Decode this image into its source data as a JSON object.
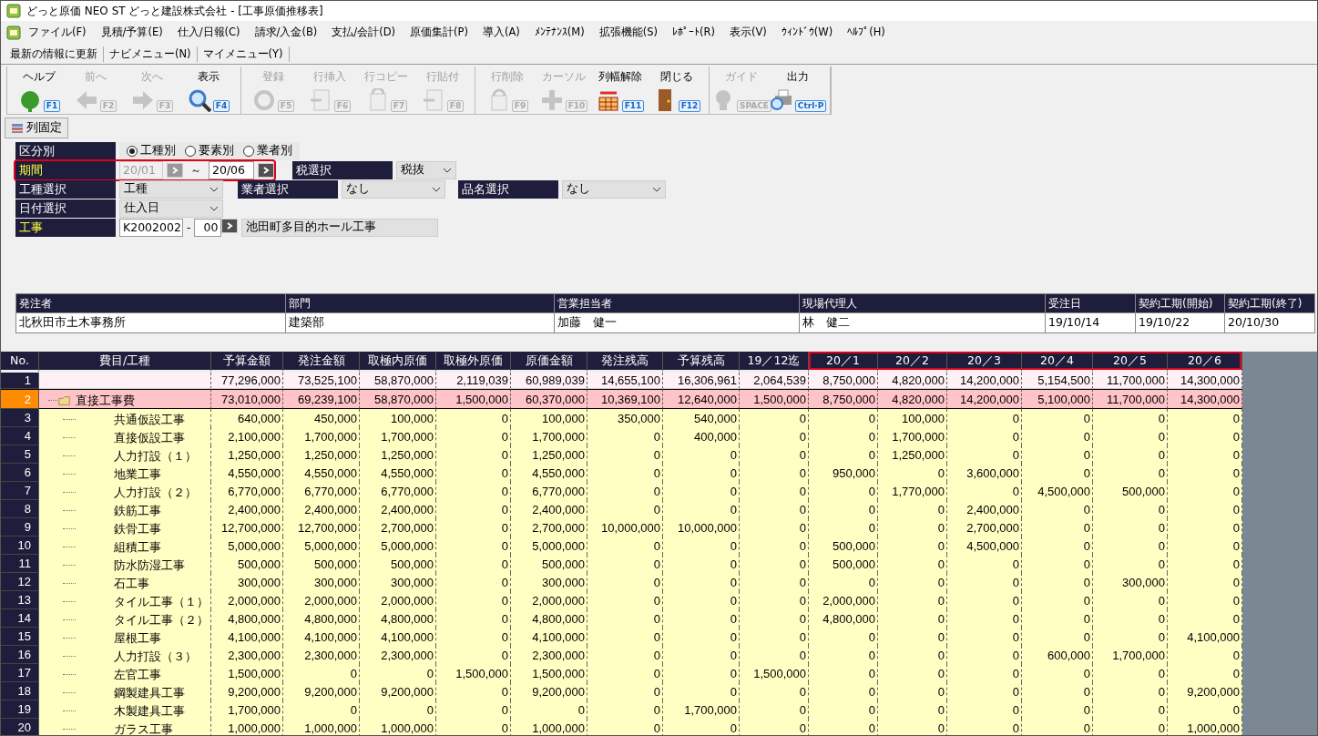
{
  "window": {
    "title": "どっと原価 NEO ST どっと建設株式会社 - [工事原価推移表]"
  },
  "menu_bar": [
    "ファイル(F)",
    "見積/予算(E)",
    "仕入/日報(C)",
    "請求/入金(B)",
    "支払/会計(D)",
    "原価集計(P)",
    "導入(A)",
    "ﾒﾝﾃﾅﾝｽ(M)",
    "拡張機能(S)",
    "ﾚﾎﾟｰﾄ(R)",
    "表示(V)",
    "ｳｨﾝﾄﾞｳ(W)",
    "ﾍﾙﾌﾟ(H)"
  ],
  "quick_bar": [
    "最新の情報に更新",
    "ナビメニュー(N)",
    "マイメニュー(Y)"
  ],
  "toolbar": {
    "groups": [
      [
        {
          "label": "ヘルプ",
          "key": "F1",
          "disabled": false
        },
        {
          "label": "前へ",
          "key": "F2",
          "disabled": true
        },
        {
          "label": "次へ",
          "key": "F3",
          "disabled": true
        },
        {
          "label": "表示",
          "key": "F4",
          "disabled": false
        }
      ],
      [
        {
          "label": "登録",
          "key": "F5",
          "disabled": true
        },
        {
          "label": "行挿入",
          "key": "F6",
          "disabled": true
        },
        {
          "label": "行コピー",
          "key": "F7",
          "disabled": true
        },
        {
          "label": "行貼付",
          "key": "F8",
          "disabled": true
        }
      ],
      [
        {
          "label": "行削除",
          "key": "F9",
          "disabled": true
        },
        {
          "label": "カーソル",
          "key": "F10",
          "disabled": true
        },
        {
          "label": "列幅解除",
          "key": "F11",
          "disabled": false
        },
        {
          "label": "閉じる",
          "key": "F12",
          "disabled": false
        }
      ],
      [
        {
          "label": "ガイド",
          "key": "SPACE",
          "disabled": true
        },
        {
          "label": "出力",
          "key": "Ctrl·P",
          "disabled": false
        }
      ]
    ]
  },
  "freeze_button": "列固定",
  "filters": {
    "grouping": {
      "label": "区分別",
      "options": [
        {
          "label": "工種別",
          "selected": true
        },
        {
          "label": "要素別",
          "selected": false
        },
        {
          "label": "業者別",
          "selected": false
        }
      ]
    },
    "period": {
      "label": "期間",
      "required": true,
      "highlighted": true,
      "from": {
        "value": "20/01",
        "disabled": true
      },
      "separator": "～",
      "to": {
        "value": "20/06",
        "disabled": false
      }
    },
    "tax": {
      "label": "税選択",
      "value": "税抜"
    },
    "trade": {
      "label": "工種選択",
      "value": "工種"
    },
    "vendor": {
      "label": "業者選択",
      "value": "なし"
    },
    "item": {
      "label": "品名選択",
      "value": "なし"
    },
    "date": {
      "label": "日付選択",
      "value": "仕入日"
    },
    "project": {
      "label": "工事",
      "required": true,
      "code": "K2002002",
      "dash": "-",
      "branch": "00",
      "name": "池田町多目的ホール工事"
    }
  },
  "info_table": {
    "columns": [
      "発注者",
      "部門",
      "営業担当者",
      "現場代理人",
      "受注日",
      "契約工期(開始)",
      "契約工期(終了)"
    ],
    "values": [
      "北秋田市土木事務所",
      "建築部",
      "加藤　健一",
      "林　健二",
      "19/10/14",
      "19/10/22",
      "20/10/30"
    ]
  },
  "grid": {
    "columns": [
      {
        "label": "No.",
        "highlighted": false
      },
      {
        "label": "費目/工種",
        "highlighted": false
      },
      {
        "label": "予算金額",
        "highlighted": false
      },
      {
        "label": "発注金額",
        "highlighted": false
      },
      {
        "label": "取極内原価",
        "highlighted": false
      },
      {
        "label": "取極外原価",
        "highlighted": false
      },
      {
        "label": "原価金額",
        "highlighted": false
      },
      {
        "label": "発注残高",
        "highlighted": false
      },
      {
        "label": "予算残高",
        "highlighted": false
      },
      {
        "label": "19／12迄",
        "highlighted": false
      },
      {
        "label": "20／1",
        "highlighted": true
      },
      {
        "label": "20／2",
        "highlighted": true
      },
      {
        "label": "20／3",
        "highlighted": true
      },
      {
        "label": "20／4",
        "highlighted": true
      },
      {
        "label": "20／5",
        "highlighted": true
      },
      {
        "label": "20／6",
        "highlighted": true
      }
    ],
    "rows": [
      {
        "no": "1",
        "kind": "total",
        "selected": false,
        "values": [
          "77,296,000",
          "73,525,100",
          "58,870,000",
          "2,119,039",
          "60,989,039",
          "14,655,100",
          "16,306,961",
          "2,064,539",
          "8,750,000",
          "4,820,000",
          "14,200,000",
          "5,154,500",
          "11,700,000",
          "14,300,000"
        ]
      },
      {
        "no": "2",
        "kind": "group",
        "name": "直接工事費",
        "selected": true,
        "values": [
          "73,010,000",
          "69,239,100",
          "58,870,000",
          "1,500,000",
          "60,370,000",
          "10,369,100",
          "12,640,000",
          "1,500,000",
          "8,750,000",
          "4,820,000",
          "14,200,000",
          "5,100,000",
          "11,700,000",
          "14,300,000"
        ],
        "children": [
          {
            "no": "3",
            "kind": "item",
            "name": "共通仮設工事",
            "selected": false,
            "values": [
              "640,000",
              "450,000",
              "100,000",
              "0",
              "100,000",
              "350,000",
              "540,000",
              "0",
              "0",
              "100,000",
              "0",
              "0",
              "0",
              "0"
            ]
          },
          {
            "no": "4",
            "kind": "item",
            "name": "直接仮設工事",
            "selected": false,
            "values": [
              "2,100,000",
              "1,700,000",
              "1,700,000",
              "0",
              "1,700,000",
              "0",
              "400,000",
              "0",
              "0",
              "1,700,000",
              "0",
              "0",
              "0",
              "0"
            ]
          },
          {
            "no": "5",
            "kind": "item",
            "name": "人力打設（１）",
            "selected": false,
            "values": [
              "1,250,000",
              "1,250,000",
              "1,250,000",
              "0",
              "1,250,000",
              "0",
              "0",
              "0",
              "0",
              "1,250,000",
              "0",
              "0",
              "0",
              "0"
            ]
          },
          {
            "no": "6",
            "kind": "item",
            "name": "地業工事",
            "selected": false,
            "values": [
              "4,550,000",
              "4,550,000",
              "4,550,000",
              "0",
              "4,550,000",
              "0",
              "0",
              "0",
              "950,000",
              "0",
              "3,600,000",
              "0",
              "0",
              "0"
            ]
          },
          {
            "no": "7",
            "kind": "item",
            "name": "人力打設（２）",
            "selected": false,
            "values": [
              "6,770,000",
              "6,770,000",
              "6,770,000",
              "0",
              "6,770,000",
              "0",
              "0",
              "0",
              "0",
              "1,770,000",
              "0",
              "4,500,000",
              "500,000",
              "0"
            ]
          },
          {
            "no": "8",
            "kind": "item",
            "name": "鉄筋工事",
            "selected": false,
            "values": [
              "2,400,000",
              "2,400,000",
              "2,400,000",
              "0",
              "2,400,000",
              "0",
              "0",
              "0",
              "0",
              "0",
              "2,400,000",
              "0",
              "0",
              "0"
            ]
          },
          {
            "no": "9",
            "kind": "item",
            "name": "鉄骨工事",
            "selected": false,
            "values": [
              "12,700,000",
              "12,700,000",
              "2,700,000",
              "0",
              "2,700,000",
              "10,000,000",
              "10,000,000",
              "0",
              "0",
              "0",
              "2,700,000",
              "0",
              "0",
              "0"
            ]
          },
          {
            "no": "10",
            "kind": "item",
            "name": "組積工事",
            "selected": false,
            "values": [
              "5,000,000",
              "5,000,000",
              "5,000,000",
              "0",
              "5,000,000",
              "0",
              "0",
              "0",
              "500,000",
              "0",
              "4,500,000",
              "0",
              "0",
              "0"
            ]
          },
          {
            "no": "11",
            "kind": "item",
            "name": "防水防湿工事",
            "selected": false,
            "values": [
              "500,000",
              "500,000",
              "500,000",
              "0",
              "500,000",
              "0",
              "0",
              "0",
              "500,000",
              "0",
              "0",
              "0",
              "0",
              "0"
            ]
          },
          {
            "no": "12",
            "kind": "item",
            "name": "石工事",
            "selected": false,
            "values": [
              "300,000",
              "300,000",
              "300,000",
              "0",
              "300,000",
              "0",
              "0",
              "0",
              "0",
              "0",
              "0",
              "0",
              "300,000",
              "0"
            ]
          },
          {
            "no": "13",
            "kind": "item",
            "name": "タイル工事（１）",
            "selected": false,
            "values": [
              "2,000,000",
              "2,000,000",
              "2,000,000",
              "0",
              "2,000,000",
              "0",
              "0",
              "0",
              "2,000,000",
              "0",
              "0",
              "0",
              "0",
              "0"
            ]
          },
          {
            "no": "14",
            "kind": "item",
            "name": "タイル工事（２）",
            "selected": false,
            "values": [
              "4,800,000",
              "4,800,000",
              "4,800,000",
              "0",
              "4,800,000",
              "0",
              "0",
              "0",
              "4,800,000",
              "0",
              "0",
              "0",
              "0",
              "0"
            ]
          },
          {
            "no": "15",
            "kind": "item",
            "name": "屋根工事",
            "selected": false,
            "values": [
              "4,100,000",
              "4,100,000",
              "4,100,000",
              "0",
              "4,100,000",
              "0",
              "0",
              "0",
              "0",
              "0",
              "0",
              "0",
              "0",
              "4,100,000"
            ]
          },
          {
            "no": "16",
            "kind": "item",
            "name": "人力打設（３）",
            "selected": false,
            "values": [
              "2,300,000",
              "2,300,000",
              "2,300,000",
              "0",
              "2,300,000",
              "0",
              "0",
              "0",
              "0",
              "0",
              "0",
              "600,000",
              "1,700,000",
              "0"
            ]
          },
          {
            "no": "17",
            "kind": "item",
            "name": "左官工事",
            "selected": false,
            "values": [
              "1,500,000",
              "0",
              "0",
              "1,500,000",
              "1,500,000",
              "0",
              "0",
              "1,500,000",
              "0",
              "0",
              "0",
              "0",
              "0",
              "0"
            ]
          },
          {
            "no": "18",
            "kind": "item",
            "name": "鋼製建具工事",
            "selected": false,
            "values": [
              "9,200,000",
              "9,200,000",
              "9,200,000",
              "0",
              "9,200,000",
              "0",
              "0",
              "0",
              "0",
              "0",
              "0",
              "0",
              "0",
              "9,200,000"
            ]
          },
          {
            "no": "19",
            "kind": "item",
            "name": "木製建具工事",
            "selected": false,
            "values": [
              "1,700,000",
              "0",
              "0",
              "0",
              "0",
              "0",
              "1,700,000",
              "0",
              "0",
              "0",
              "0",
              "0",
              "0",
              "0"
            ]
          },
          {
            "no": "20",
            "kind": "item",
            "name": "ガラス工事",
            "selected": false,
            "values": [
              "1,000,000",
              "1,000,000",
              "1,000,000",
              "0",
              "1,000,000",
              "0",
              "0",
              "0",
              "0",
              "0",
              "0",
              "0",
              "0",
              "1,000,000"
            ]
          }
        ]
      }
    ]
  }
}
